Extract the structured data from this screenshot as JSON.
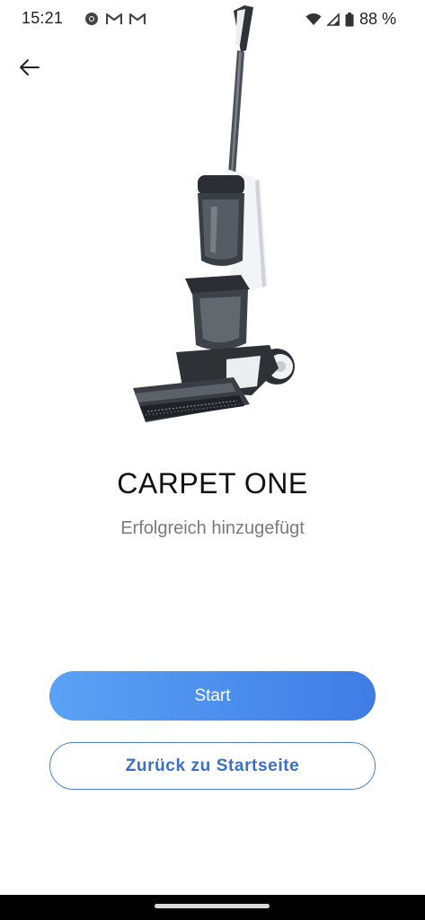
{
  "status_bar": {
    "time": "15:21",
    "left_icons": [
      "chrome-icon",
      "gmail-icon",
      "gmail-icon"
    ],
    "battery": "88 %",
    "right_icons": [
      "wifi-icon",
      "signal-icon",
      "battery-icon"
    ]
  },
  "header": {
    "back_icon": "arrow-left-icon"
  },
  "product": {
    "name": "CARPET ONE",
    "message": "Erfolgreich hinzugefügt",
    "image": "wet-dry-vacuum-image"
  },
  "actions": {
    "start_label": "Start",
    "home_label": "Zurück zu Startseite"
  },
  "colors": {
    "primary_gradient_start": "#5aa2f5",
    "primary_gradient_end": "#3f7de6",
    "outline": "#4a7fd6",
    "subtitle": "#7a7a7a"
  }
}
